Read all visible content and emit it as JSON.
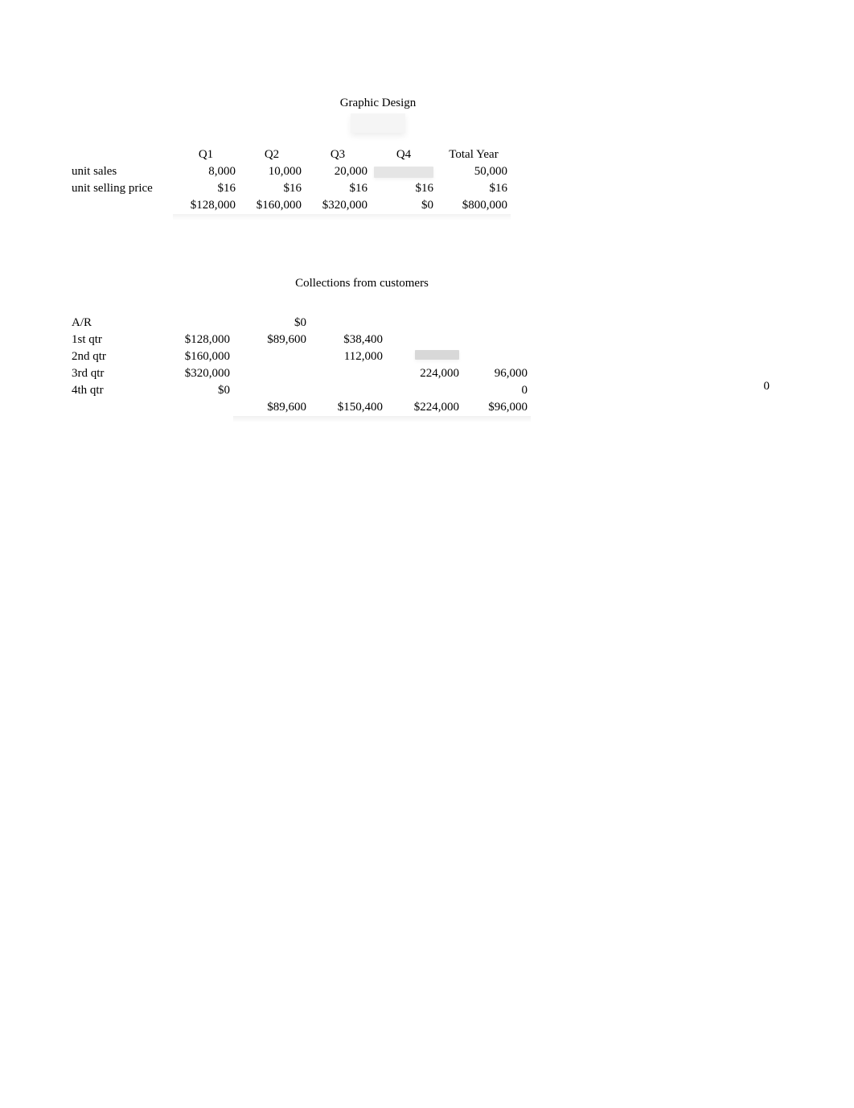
{
  "section1": {
    "title": "Graphic Design",
    "headers": [
      "Q1",
      "Q2",
      "Q3",
      "Q4",
      "Total Year"
    ],
    "rows": [
      {
        "label": "unit sales",
        "cells": [
          "8,000",
          "10,000",
          "20,000",
          "",
          "50,000"
        ],
        "blurred": [
          false,
          false,
          false,
          true,
          false
        ]
      },
      {
        "label": "unit selling price",
        "cells": [
          "$16",
          "$16",
          "$16",
          "$16",
          "$16"
        ],
        "blurred": [
          false,
          false,
          false,
          false,
          false
        ]
      },
      {
        "label": "",
        "cells": [
          "$128,000",
          "$160,000",
          "$320,000",
          "$0",
          "$800,000"
        ],
        "blurred": [
          false,
          false,
          false,
          false,
          false
        ]
      }
    ]
  },
  "section2": {
    "title": "Collections from customers",
    "rows": [
      {
        "label": "A/R",
        "cells": [
          "",
          "$0",
          "",
          "",
          ""
        ],
        "blurred": [
          false,
          false,
          false,
          false,
          false
        ]
      },
      {
        "label": "1st qtr",
        "cells": [
          "$128,000",
          "$89,600",
          "$38,400",
          "",
          ""
        ],
        "blurred": [
          false,
          false,
          false,
          false,
          false
        ]
      },
      {
        "label": "2nd qtr",
        "cells": [
          "$160,000",
          "",
          "112,000",
          "",
          ""
        ],
        "blurred": [
          false,
          false,
          false,
          true,
          false
        ]
      },
      {
        "label": "3rd qtr",
        "cells": [
          "$320,000",
          "",
          "",
          "224,000",
          "96,000"
        ],
        "blurred": [
          false,
          false,
          false,
          false,
          false
        ]
      },
      {
        "label": "4th qtr",
        "cells": [
          "$0",
          "",
          "",
          "",
          "0"
        ],
        "blurred": [
          false,
          false,
          false,
          false,
          false
        ]
      }
    ],
    "totals": [
      "",
      "$89,600",
      "$150,400",
      "$224,000",
      "$96,000"
    ],
    "floating_zero": "0"
  }
}
